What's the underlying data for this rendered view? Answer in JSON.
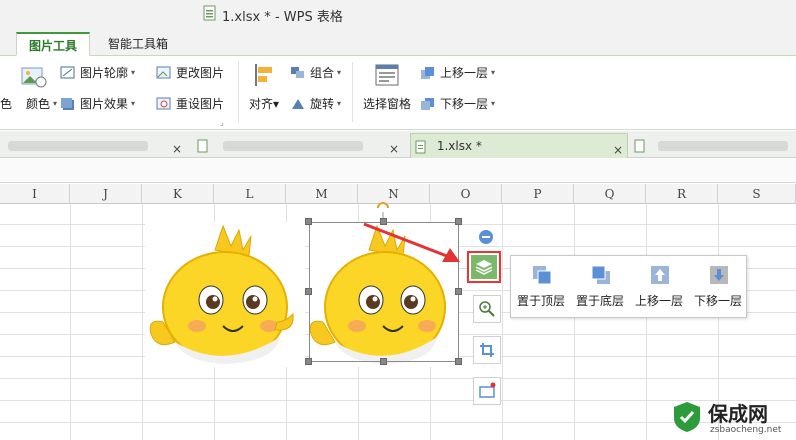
{
  "window": {
    "title": "1.xlsx * - WPS 表格"
  },
  "ribbon_tabs": [
    {
      "label": "图片工具",
      "active": true
    },
    {
      "label": "智能工具箱",
      "active": false
    }
  ],
  "ribbon": {
    "insert_pic_partial": "色",
    "color": "颜色",
    "outline": "图片轮廓",
    "effect": "图片效果",
    "change_pic": "更改图片",
    "reset_pic": "重设图片",
    "align": "对齐",
    "group": "组合",
    "rotate": "旋转",
    "selection_pane": "选择窗格",
    "bring_forward": "上移一层",
    "send_backward": "下移一层"
  },
  "doc_tabs": {
    "active_file": "1.xlsx *"
  },
  "columns": [
    "I",
    "J",
    "K",
    "L",
    "M",
    "N",
    "O",
    "P",
    "Q",
    "R",
    "S"
  ],
  "layer_popup": {
    "items": [
      "置于顶层",
      "置于底层",
      "上移一层",
      "下移一层"
    ]
  },
  "watermark": {
    "name": "保成网",
    "url": "zsbaocheng.net"
  },
  "colors": {
    "accent": "#3f9b3f",
    "highlight": "#e33333",
    "layer_btn": "#7cb86a",
    "icon_blue": "#5b8fd6"
  }
}
